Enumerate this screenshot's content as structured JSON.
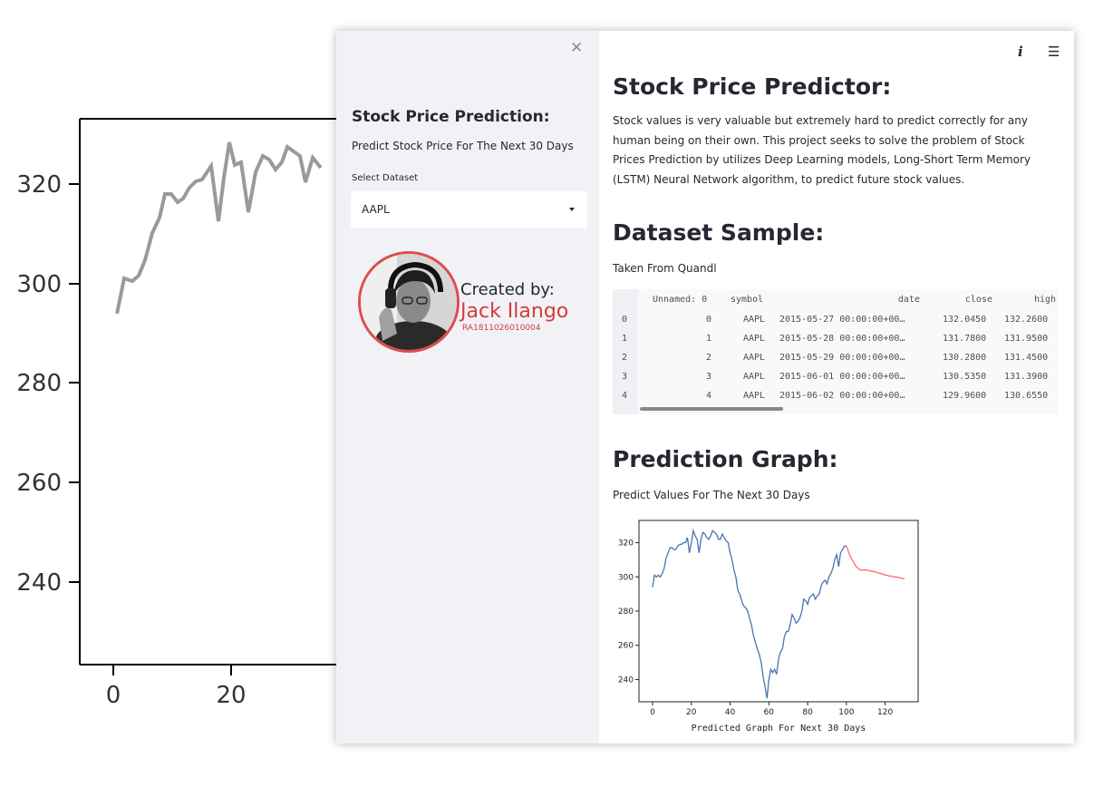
{
  "background_chart": {
    "y_ticks": [
      "320",
      "300",
      "280",
      "260",
      "240"
    ],
    "x_ticks": [
      "0",
      "20"
    ]
  },
  "sidebar": {
    "close_icon": "close-icon",
    "title": "Stock Price Prediction:",
    "subtitle": "Predict Stock Price For The Next 30 Days",
    "select_label": "Select Dataset",
    "select_value": "AAPL",
    "created_by": "Created by:",
    "creator_name": "Jack Ilango",
    "creator_id": "RA1811026010004"
  },
  "main": {
    "info_icon": "info-icon",
    "menu_icon": "hamburger-menu-icon",
    "title": "Stock Price Predictor:",
    "description": "Stock values is very valuable but extremely hard to predict correctly for any human being on their own. This project seeks to solve the problem of Stock Prices Prediction by utilizes Deep Learning models, Long-Short Term Memory (LSTM) Neural Network algorithm, to predict future stock values.",
    "dataset_heading": "Dataset Sample:",
    "dataset_caption": "Taken From Quandl",
    "table": {
      "columns": [
        "Unnamed: 0",
        "symbol",
        "date",
        "close",
        "high"
      ],
      "rows": [
        {
          "index": "0",
          "cells": [
            "0",
            "AAPL",
            "2015-05-27 00:00:00+00…",
            "132.0450",
            "132.2600"
          ]
        },
        {
          "index": "1",
          "cells": [
            "1",
            "AAPL",
            "2015-05-28 00:00:00+00…",
            "131.7800",
            "131.9500"
          ]
        },
        {
          "index": "2",
          "cells": [
            "2",
            "AAPL",
            "2015-05-29 00:00:00+00…",
            "130.2800",
            "131.4500"
          ]
        },
        {
          "index": "3",
          "cells": [
            "3",
            "AAPL",
            "2015-06-01 00:00:00+00…",
            "130.5350",
            "131.3900"
          ]
        },
        {
          "index": "4",
          "cells": [
            "4",
            "AAPL",
            "2015-06-02 00:00:00+00…",
            "129.9600",
            "130.6550"
          ]
        }
      ]
    },
    "prediction_heading": "Prediction Graph:",
    "prediction_caption": "Predict Values For The Next 30 Days"
  },
  "chart_data": {
    "type": "line",
    "xlabel": "Predicted Graph For Next 30 Days",
    "xlim": [
      -7,
      137
    ],
    "ylim": [
      227,
      333
    ],
    "x_ticks": [
      0,
      20,
      40,
      60,
      80,
      100,
      120
    ],
    "y_ticks": [
      240,
      260,
      280,
      300,
      320
    ],
    "colors": {
      "history": "#4c72b0",
      "prediction": "#ff6b6b"
    },
    "series": [
      {
        "x_start": 0,
        "values": [
          294,
          301,
          300,
          301,
          300,
          302,
          305,
          311,
          314,
          317,
          317,
          316,
          316,
          318,
          319,
          319,
          320,
          320,
          323,
          314,
          320,
          327,
          324,
          322,
          314,
          322,
          326,
          325,
          323,
          322,
          324,
          327,
          326,
          325,
          322,
          322,
          325,
          323,
          321,
          320,
          314,
          310,
          304,
          300,
          292,
          290,
          286,
          283,
          282,
          280,
          276,
          272,
          266,
          262,
          258,
          255,
          250,
          242,
          236,
          229,
          240,
          246,
          244,
          246,
          243,
          252,
          256,
          258,
          265,
          268,
          268,
          272,
          278,
          276,
          273,
          274,
          276,
          280,
          287,
          286,
          284,
          288,
          289,
          290,
          287,
          289,
          290,
          295,
          297,
          298,
          296,
          300,
          302,
          305,
          310,
          313,
          306,
          314,
          316,
          318,
          318
        ]
      },
      {
        "x_start": 100,
        "values": [
          318,
          315,
          312,
          310,
          308,
          306,
          305,
          304,
          304,
          304,
          304,
          304,
          303.5,
          303.5,
          303,
          303,
          302.5,
          302,
          302,
          301.5,
          301,
          301,
          300.5,
          300.5,
          300,
          300,
          300,
          299.5,
          299.5,
          299,
          299
        ]
      }
    ]
  }
}
